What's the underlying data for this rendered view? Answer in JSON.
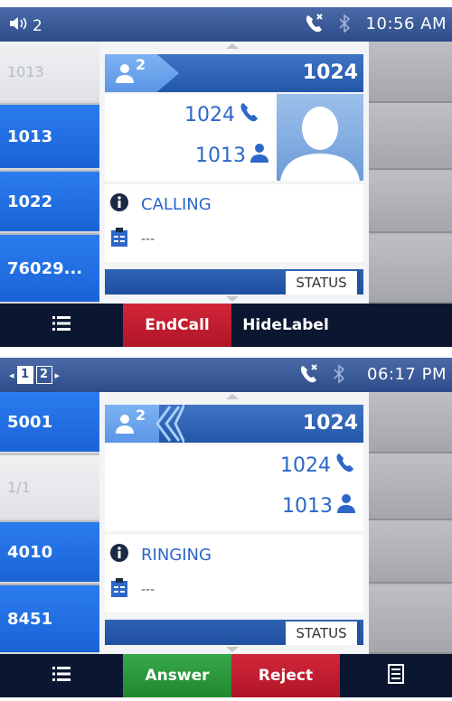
{
  "screen1": {
    "status_bar": {
      "left_text": "2",
      "time": "10:56 AM"
    },
    "left_keys": [
      "1013",
      "1013",
      "1022",
      "76029..."
    ],
    "header_badge": "2",
    "header_number": "1024",
    "remote_number": "1024",
    "local_number": "1013",
    "call_state": "CALLING",
    "note": "---",
    "status_button": "STATUS",
    "softkeys": {
      "menu_icon": "list-icon",
      "endcall": "EndCall",
      "hidelabel": "HideLabel"
    }
  },
  "screen2": {
    "status_bar": {
      "page_active": "1",
      "page_inactive": "2",
      "time": "06:17 PM"
    },
    "left_keys": [
      "5001",
      "1/1",
      "4010",
      "8451"
    ],
    "header_badge": "2",
    "header_number": "1024",
    "remote_number": "1024",
    "local_number": "1013",
    "call_state": "RINGING",
    "note": "---",
    "status_button": "STATUS",
    "softkeys": {
      "menu_icon": "list-icon",
      "answer": "Answer",
      "reject": "Reject",
      "doc_icon": "document-icon"
    }
  },
  "colors": {
    "accent_blue": "#1a63d6",
    "endcall_red": "#b01526",
    "answer_green": "#21872f",
    "softkey_bg": "#0b1730"
  }
}
